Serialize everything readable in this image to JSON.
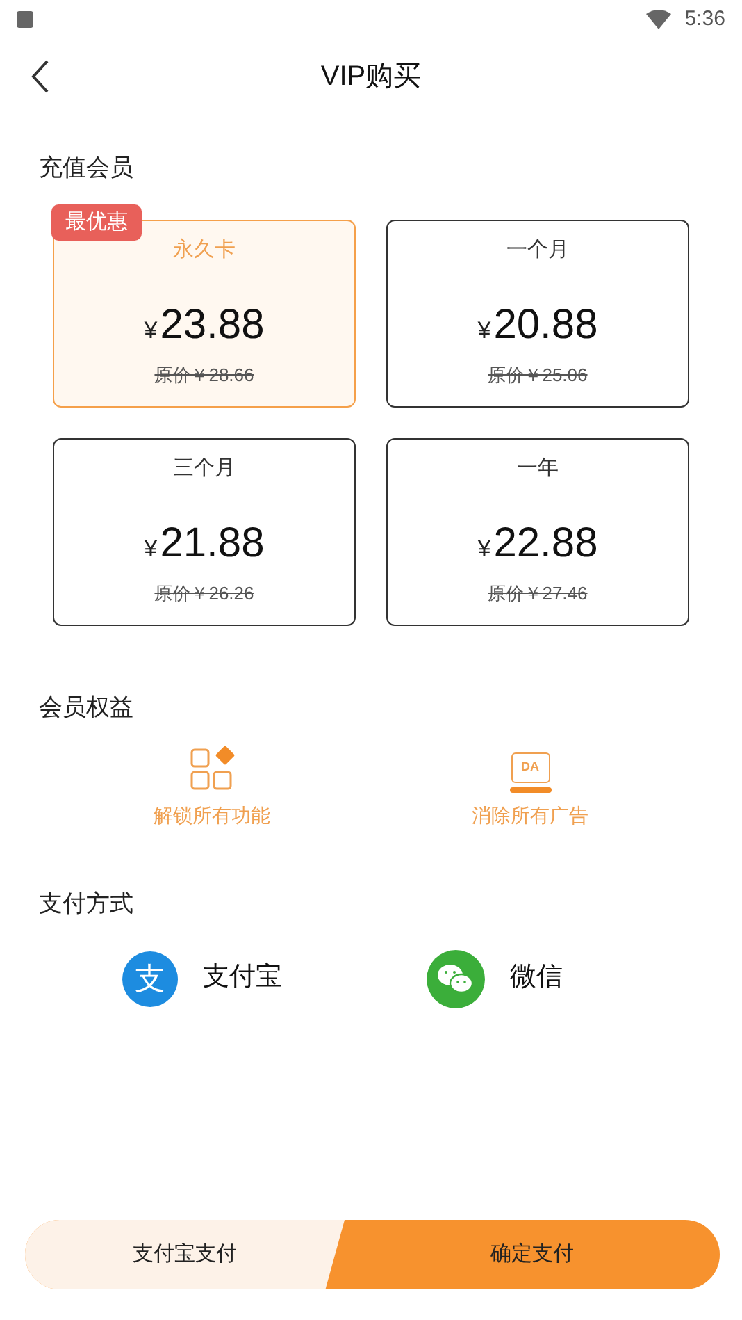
{
  "status_bar": {
    "time": "5:36"
  },
  "header": {
    "title": "VIP购买"
  },
  "plans_section": {
    "title": "充值会员"
  },
  "plans": [
    {
      "name": "永久卡",
      "price": "23.88",
      "currency": "¥",
      "original": "原价￥28.66",
      "badge": "最优惠",
      "selected": true
    },
    {
      "name": "一个月",
      "price": "20.88",
      "currency": "¥",
      "original": "原价￥25.06",
      "selected": false
    },
    {
      "name": "三个月",
      "price": "21.88",
      "currency": "¥",
      "original": "原价￥26.26",
      "selected": false
    },
    {
      "name": "一年",
      "price": "22.88",
      "currency": "¥",
      "original": "原价￥27.46",
      "selected": false
    }
  ],
  "benefits_section": {
    "title": "会员权益"
  },
  "benefits": [
    {
      "kind": "features",
      "label": "解锁所有功能"
    },
    {
      "kind": "ads",
      "label": "消除所有广告",
      "icon_text": "DA"
    }
  ],
  "payment_section": {
    "title": "支付方式"
  },
  "payment_methods": [
    {
      "kind": "alipay",
      "label": "支付宝",
      "icon_text": "支"
    },
    {
      "kind": "wechat",
      "label": "微信"
    }
  ],
  "bottom_bar": {
    "method": "支付宝支付",
    "confirm": "确定支付"
  }
}
